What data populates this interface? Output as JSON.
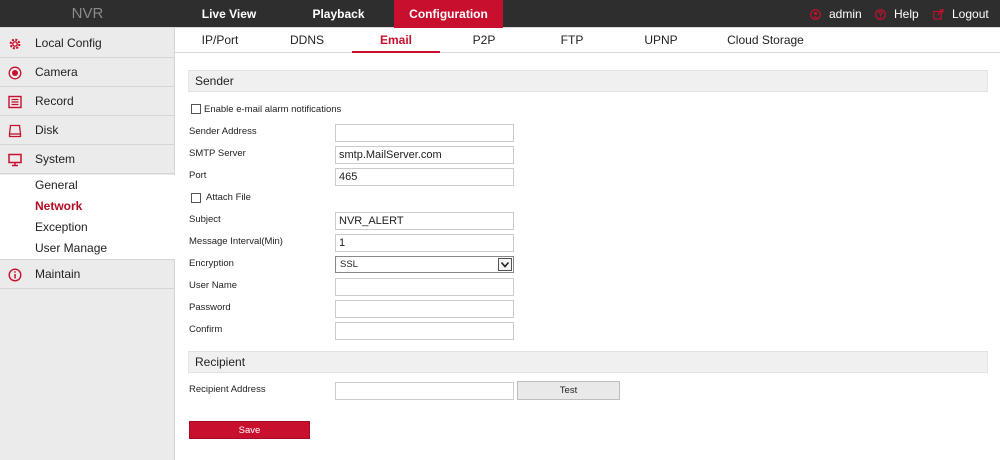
{
  "brand": "NVR",
  "colors": {
    "accent": "#c8102e",
    "topbar": "#2e2e2e",
    "sidebar": "#ebebeb"
  },
  "topnav": {
    "live_view": "Live View",
    "playback": "Playback",
    "configuration": "Configuration",
    "active": "configuration"
  },
  "user": {
    "name": "admin",
    "help": "Help",
    "logout": "Logout",
    "icons": [
      "user-icon",
      "help-icon",
      "logout-icon"
    ]
  },
  "sidebar": {
    "items": [
      {
        "label": "Local Config",
        "icon": "gear-icon"
      },
      {
        "label": "Camera",
        "icon": "camera-icon"
      },
      {
        "label": "Record",
        "icon": "record-icon"
      },
      {
        "label": "Disk",
        "icon": "disk-icon"
      },
      {
        "label": "System",
        "icon": "monitor-icon"
      },
      {
        "label": "Maintain",
        "icon": "info-icon"
      }
    ],
    "system_sub": [
      "General",
      "Network",
      "Exception",
      "User Manage"
    ],
    "active_sub": "Network"
  },
  "tabs": {
    "items": [
      "IP/Port",
      "DDNS",
      "Email",
      "P2P",
      "FTP",
      "UPNP",
      "Cloud Storage"
    ],
    "active": "Email"
  },
  "email": {
    "sender_title": "Sender",
    "enable_label": "Enable e-mail alarm notifications",
    "enable_checked": false,
    "sender_address_label": "Sender Address",
    "sender_address_value": "",
    "smtp_server_label": "SMTP Server",
    "smtp_server_value": "smtp.MailServer.com",
    "port_label": "Port",
    "port_value": "465",
    "attach_label": "Attach File",
    "attach_checked": false,
    "subject_label": "Subject",
    "subject_value": "NVR_ALERT",
    "interval_label": "Message Interval(Min)",
    "interval_value": "1",
    "encryption_label": "Encryption",
    "encryption_value": "SSL",
    "username_label": "User Name",
    "username_value": "",
    "password_label": "Password",
    "password_value": "",
    "confirm_label": "Confirm",
    "confirm_value": "",
    "recipient_title": "Recipient",
    "recipient_address_label": "Recipient Address",
    "recipient_address_value": "",
    "test_button": "Test",
    "save_button": "Save"
  }
}
